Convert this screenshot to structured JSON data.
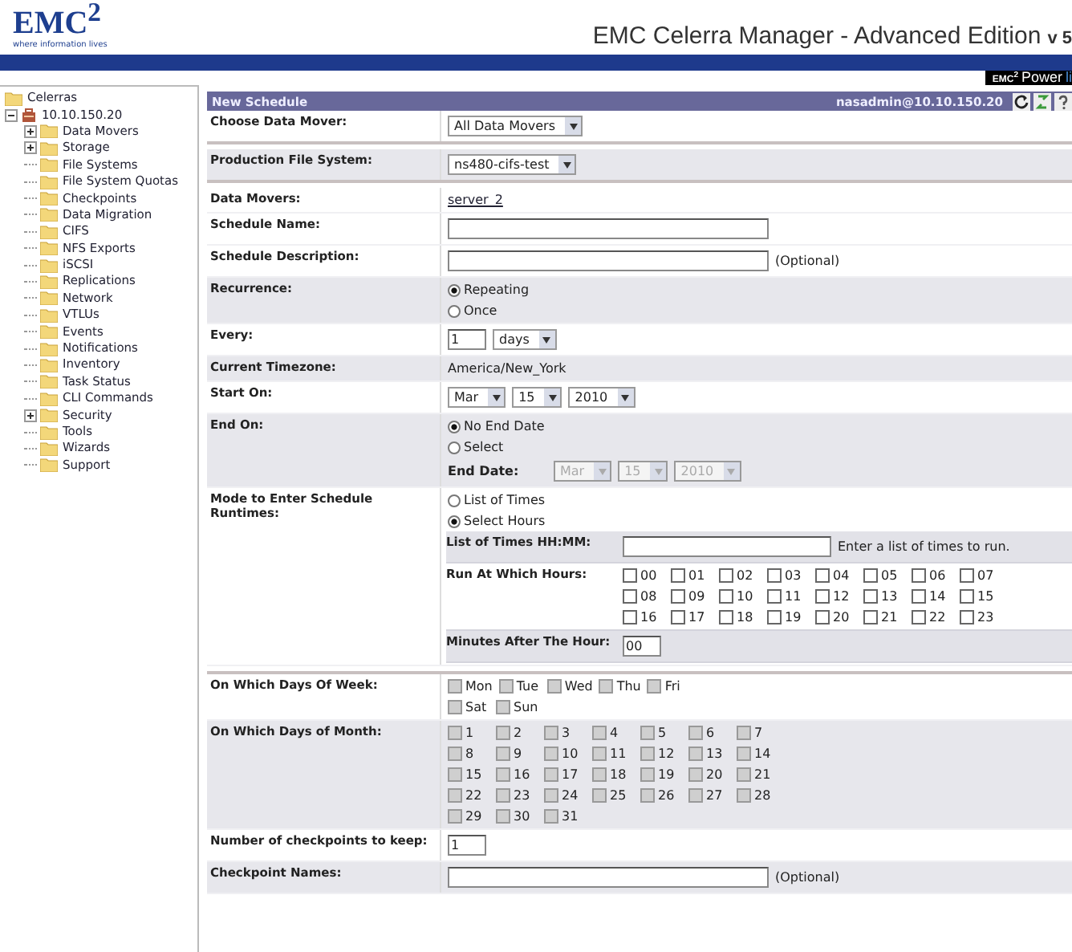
{
  "header": {
    "logo": "EMC$^{2}$",
    "tagline": "where information lives",
    "title": "EMC Celerra Manager - Advanced Edition",
    "version": "v 5",
    "badge": {
      "mark": "EMC$^{2}$",
      "text": "Power",
      "accent": "li"
    }
  },
  "sidebar": {
    "tree": [
      {
        "label": "Celerras",
        "kind": "folder",
        "children": [
          {
            "label": "10.10.150.20",
            "kind": "server",
            "expanded": true,
            "children": [
              {
                "label": "Data Movers",
                "kind": "folder",
                "expanded": false
              },
              {
                "label": "Storage",
                "kind": "folder",
                "expanded": false
              },
              {
                "label": "File Systems",
                "kind": "folder"
              },
              {
                "label": "File System Quotas",
                "kind": "folder"
              },
              {
                "label": "Checkpoints",
                "kind": "folder"
              },
              {
                "label": "Data Migration",
                "kind": "folder"
              },
              {
                "label": "CIFS",
                "kind": "folder"
              },
              {
                "label": "NFS Exports",
                "kind": "folder"
              },
              {
                "label": "iSCSI",
                "kind": "folder"
              },
              {
                "label": "Replications",
                "kind": "folder"
              },
              {
                "label": "Network",
                "kind": "folder"
              },
              {
                "label": "VTLUs",
                "kind": "folder"
              },
              {
                "label": "Events",
                "kind": "folder"
              },
              {
                "label": "Notifications",
                "kind": "folder"
              },
              {
                "label": "Inventory",
                "kind": "folder"
              },
              {
                "label": "Task Status",
                "kind": "folder"
              },
              {
                "label": "CLI Commands",
                "kind": "folder"
              },
              {
                "label": "Security",
                "kind": "folder",
                "expanded": false
              },
              {
                "label": "Tools",
                "kind": "folder"
              },
              {
                "label": "Wizards",
                "kind": "folder"
              },
              {
                "label": "Support",
                "kind": "folder"
              }
            ]
          }
        ]
      }
    ]
  },
  "panel": {
    "title": "New Schedule",
    "user": "nasadmin@10.10.150.20"
  },
  "form": {
    "rows": [
      {
        "label": "Choose Data Mover:",
        "shaded": false,
        "rule_after": true,
        "lines": [
          [
            {
              "kind": "select",
              "value": "All Data Movers",
              "disabled": false
            }
          ]
        ]
      },
      {
        "label": "Production File System:",
        "shaded": true,
        "rule_after": true,
        "lines": [
          [
            {
              "kind": "select",
              "value": "ns480-cifs-test",
              "disabled": false
            }
          ]
        ]
      },
      {
        "label": "Data Movers:",
        "shaded": false,
        "lines": [
          [
            {
              "kind": "link",
              "text": "server_2"
            }
          ]
        ]
      },
      {
        "label": "Schedule Name:",
        "shaded": false,
        "lines": [
          [
            {
              "kind": "input",
              "wide": true
            }
          ]
        ]
      },
      {
        "label": "Schedule Description:",
        "shaded": false,
        "lines": [
          [
            {
              "kind": "input",
              "wide": true
            },
            {
              "kind": "note",
              "text": "(Optional)"
            }
          ]
        ]
      },
      {
        "label": "Recurrence:",
        "shaded": true,
        "lines": [
          [
            {
              "kind": "radio",
              "label": "Repeating",
              "selected": true
            }
          ],
          [
            {
              "kind": "radio",
              "label": "Once",
              "selected": false
            }
          ]
        ]
      },
      {
        "label": "Every:",
        "shaded": false,
        "lines": [
          [
            {
              "kind": "input",
              "value": "1",
              "wide": false
            },
            {
              "kind": "select",
              "value": "days",
              "disabled": false
            }
          ]
        ]
      },
      {
        "label": "Current Timezone:",
        "shaded": true,
        "lines": [
          [
            {
              "kind": "text",
              "text": "America/New_York"
            }
          ]
        ]
      },
      {
        "label": "Start On:",
        "shaded": false,
        "lines": [
          [
            {
              "kind": "select",
              "value": "Mar",
              "disabled": false
            },
            {
              "kind": "select",
              "value": "15",
              "disabled": false
            },
            {
              "kind": "select",
              "value": "2010",
              "disabled": false
            }
          ]
        ]
      },
      {
        "label": "End On:",
        "shaded": true,
        "lines": [
          [
            {
              "kind": "radio",
              "label": "No End Date",
              "selected": true
            }
          ],
          [
            {
              "kind": "radio",
              "label": "Select",
              "selected": false
            }
          ],
          [
            {
              "kind": "field_label",
              "text": "End Date:"
            },
            {
              "kind": "select",
              "value": "Mar",
              "disabled": true
            },
            {
              "kind": "select",
              "value": "15",
              "disabled": true
            },
            {
              "kind": "select",
              "value": "2010",
              "disabled": true
            }
          ]
        ]
      },
      {
        "label": "Mode to Enter Schedule Runtimes:",
        "shaded": false,
        "lines": [
          [
            {
              "kind": "radio",
              "label": "List of Times",
              "selected": false
            }
          ],
          [
            {
              "kind": "radio",
              "label": "Select Hours",
              "selected": true
            }
          ]
        ],
        "subrows": [
          {
            "label": "List of Times HH:MM:",
            "shaded": true,
            "lines": [
              [
                {
                  "kind": "input",
                  "wide": true
                },
                {
                  "kind": "note",
                  "text": "Enter a list of times to run."
                }
              ]
            ]
          },
          {
            "label": "Run At Which Hours:",
            "shaded": false,
            "lines": [
              [
                {
                  "kind": "checkbox",
                  "label": "00",
                  "checked": false,
                  "disabled": false
                },
                {
                  "kind": "checkbox",
                  "label": "01",
                  "checked": false,
                  "disabled": false
                },
                {
                  "kind": "checkbox",
                  "label": "02",
                  "checked": false,
                  "disabled": false
                },
                {
                  "kind": "checkbox",
                  "label": "03",
                  "checked": false,
                  "disabled": false
                },
                {
                  "kind": "checkbox",
                  "label": "04",
                  "checked": false,
                  "disabled": false
                },
                {
                  "kind": "checkbox",
                  "label": "05",
                  "checked": false,
                  "disabled": false
                },
                {
                  "kind": "checkbox",
                  "label": "06",
                  "checked": false,
                  "disabled": false
                },
                {
                  "kind": "checkbox",
                  "label": "07",
                  "checked": false,
                  "disabled": false
                }
              ],
              [
                {
                  "kind": "checkbox",
                  "label": "08",
                  "checked": false,
                  "disabled": false
                },
                {
                  "kind": "checkbox",
                  "label": "09",
                  "checked": false,
                  "disabled": false
                },
                {
                  "kind": "checkbox",
                  "label": "10",
                  "checked": false,
                  "disabled": false
                },
                {
                  "kind": "checkbox",
                  "label": "11",
                  "checked": false,
                  "disabled": false
                },
                {
                  "kind": "checkbox",
                  "label": "12",
                  "checked": false,
                  "disabled": false
                },
                {
                  "kind": "checkbox",
                  "label": "13",
                  "checked": false,
                  "disabled": false
                },
                {
                  "kind": "checkbox",
                  "label": "14",
                  "checked": false,
                  "disabled": false
                },
                {
                  "kind": "checkbox",
                  "label": "15",
                  "checked": false,
                  "disabled": false
                }
              ],
              [
                {
                  "kind": "checkbox",
                  "label": "16",
                  "checked": false,
                  "disabled": false
                },
                {
                  "kind": "checkbox",
                  "label": "17",
                  "checked": false,
                  "disabled": false
                },
                {
                  "kind": "checkbox",
                  "label": "18",
                  "checked": false,
                  "disabled": false
                },
                {
                  "kind": "checkbox",
                  "label": "19",
                  "checked": false,
                  "disabled": false
                },
                {
                  "kind": "checkbox",
                  "label": "20",
                  "checked": false,
                  "disabled": false
                },
                {
                  "kind": "checkbox",
                  "label": "21",
                  "checked": false,
                  "disabled": false
                },
                {
                  "kind": "checkbox",
                  "label": "22",
                  "checked": false,
                  "disabled": false
                },
                {
                  "kind": "checkbox",
                  "label": "23",
                  "checked": false,
                  "disabled": false
                }
              ]
            ]
          },
          {
            "label": "Minutes After The Hour:",
            "shaded": true,
            "lines": [
              [
                {
                  "kind": "input",
                  "value": "00",
                  "wide": false
                }
              ]
            ]
          }
        ]
      },
      {
        "label": "On Which Days Of Week:",
        "shaded": false,
        "rule_before": true,
        "lines": [
          [
            {
              "kind": "checkbox",
              "label": "Mon",
              "checked": false,
              "disabled": true
            },
            {
              "kind": "checkbox",
              "label": "Tue",
              "checked": false,
              "disabled": true
            },
            {
              "kind": "checkbox",
              "label": "Wed",
              "checked": false,
              "disabled": true
            },
            {
              "kind": "checkbox",
              "label": "Thu",
              "checked": false,
              "disabled": true
            },
            {
              "kind": "checkbox",
              "label": "Fri",
              "checked": false,
              "disabled": true
            }
          ],
          [
            {
              "kind": "checkbox",
              "label": "Sat",
              "checked": false,
              "disabled": true
            },
            {
              "kind": "checkbox",
              "label": "Sun",
              "checked": false,
              "disabled": true
            }
          ]
        ]
      },
      {
        "label": "On Which Days of Month:",
        "shaded": true,
        "lines": [
          [
            {
              "kind": "checkbox",
              "label": "1",
              "checked": false,
              "disabled": true
            },
            {
              "kind": "checkbox",
              "label": "2",
              "checked": false,
              "disabled": true
            },
            {
              "kind": "checkbox",
              "label": "3",
              "checked": false,
              "disabled": true
            },
            {
              "kind": "checkbox",
              "label": "4",
              "checked": false,
              "disabled": true
            },
            {
              "kind": "checkbox",
              "label": "5",
              "checked": false,
              "disabled": true
            },
            {
              "kind": "checkbox",
              "label": "6",
              "checked": false,
              "disabled": true
            },
            {
              "kind": "checkbox",
              "label": "7",
              "checked": false,
              "disabled": true
            }
          ],
          [
            {
              "kind": "checkbox",
              "label": "8",
              "checked": false,
              "disabled": true
            },
            {
              "kind": "checkbox",
              "label": "9",
              "checked": false,
              "disabled": true
            },
            {
              "kind": "checkbox",
              "label": "10",
              "checked": false,
              "disabled": true
            },
            {
              "kind": "checkbox",
              "label": "11",
              "checked": false,
              "disabled": true
            },
            {
              "kind": "checkbox",
              "label": "12",
              "checked": false,
              "disabled": true
            },
            {
              "kind": "checkbox",
              "label": "13",
              "checked": false,
              "disabled": true
            },
            {
              "kind": "checkbox",
              "label": "14",
              "checked": false,
              "disabled": true
            }
          ],
          [
            {
              "kind": "checkbox",
              "label": "15",
              "checked": false,
              "disabled": true
            },
            {
              "kind": "checkbox",
              "label": "16",
              "checked": false,
              "disabled": true
            },
            {
              "kind": "checkbox",
              "label": "17",
              "checked": false,
              "disabled": true
            },
            {
              "kind": "checkbox",
              "label": "18",
              "checked": false,
              "disabled": true
            },
            {
              "kind": "checkbox",
              "label": "19",
              "checked": false,
              "disabled": true
            },
            {
              "kind": "checkbox",
              "label": "20",
              "checked": false,
              "disabled": true
            },
            {
              "kind": "checkbox",
              "label": "21",
              "checked": false,
              "disabled": true
            }
          ],
          [
            {
              "kind": "checkbox",
              "label": "22",
              "checked": false,
              "disabled": true
            },
            {
              "kind": "checkbox",
              "label": "23",
              "checked": false,
              "disabled": true
            },
            {
              "kind": "checkbox",
              "label": "24",
              "checked": false,
              "disabled": true
            },
            {
              "kind": "checkbox",
              "label": "25",
              "checked": false,
              "disabled": true
            },
            {
              "kind": "checkbox",
              "label": "26",
              "checked": false,
              "disabled": true
            },
            {
              "kind": "checkbox",
              "label": "27",
              "checked": false,
              "disabled": true
            },
            {
              "kind": "checkbox",
              "label": "28",
              "checked": false,
              "disabled": true
            }
          ],
          [
            {
              "kind": "checkbox",
              "label": "29",
              "checked": false,
              "disabled": true
            },
            {
              "kind": "checkbox",
              "label": "30",
              "checked": false,
              "disabled": true
            },
            {
              "kind": "checkbox",
              "label": "31",
              "checked": false,
              "disabled": true
            }
          ]
        ]
      },
      {
        "label": "Number of checkpoints to keep:",
        "shaded": false,
        "lines": [
          [
            {
              "kind": "input",
              "value": "1",
              "wide": false
            }
          ]
        ]
      },
      {
        "label": "Checkpoint Names:",
        "shaded": true,
        "lines": [
          [
            {
              "kind": "input",
              "wide": true
            },
            {
              "kind": "note",
              "text": "(Optional)"
            }
          ]
        ]
      }
    ]
  }
}
